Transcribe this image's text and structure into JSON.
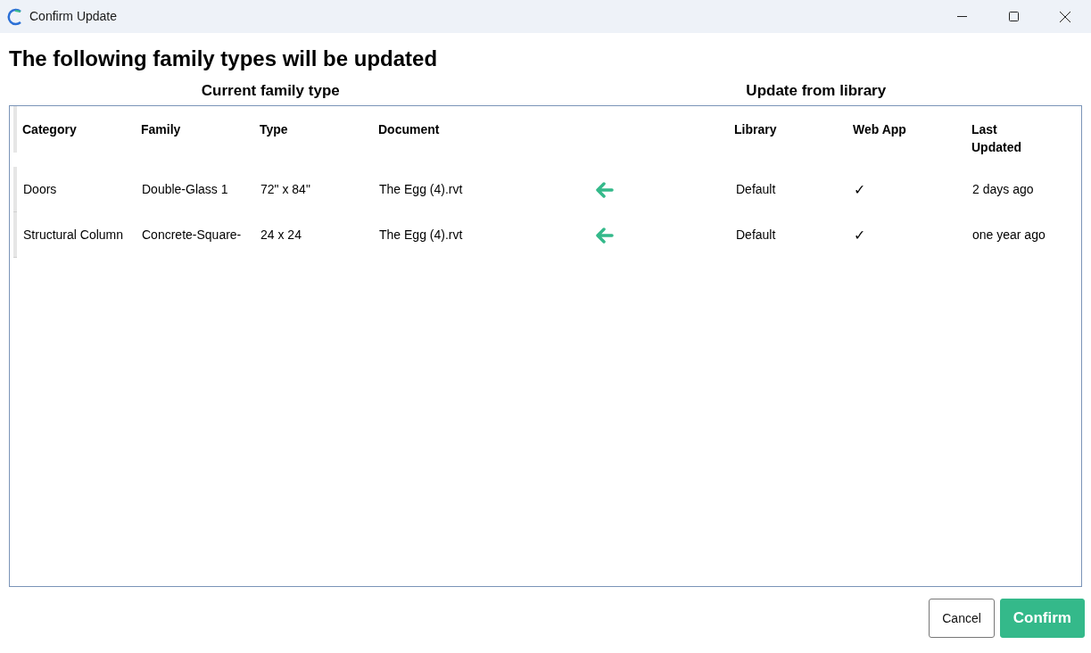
{
  "window": {
    "title": "Confirm Update"
  },
  "heading": "The following family types will be updated",
  "group_headers": [
    "Current family type",
    "Update from library"
  ],
  "table": {
    "columns": [
      "Category",
      "Family",
      "Type",
      "Document",
      "",
      "Library",
      "Web App",
      "Last Updated"
    ],
    "rows": [
      {
        "cells": [
          "Doors",
          "Double-Glass 1",
          "72\" x 84\"",
          "The Egg (4).rvt",
          "",
          "Default",
          "✓",
          "2 days ago"
        ]
      },
      {
        "cells": [
          "Structural Column",
          "Concrete-Square-",
          "24 x 24",
          "The Egg (4).rvt",
          "",
          "Default",
          "✓",
          "one year ago"
        ]
      }
    ]
  },
  "buttons": [
    {
      "label": "Cancel",
      "kind": "secondary"
    },
    {
      "label": "Confirm",
      "kind": "primary"
    }
  ]
}
